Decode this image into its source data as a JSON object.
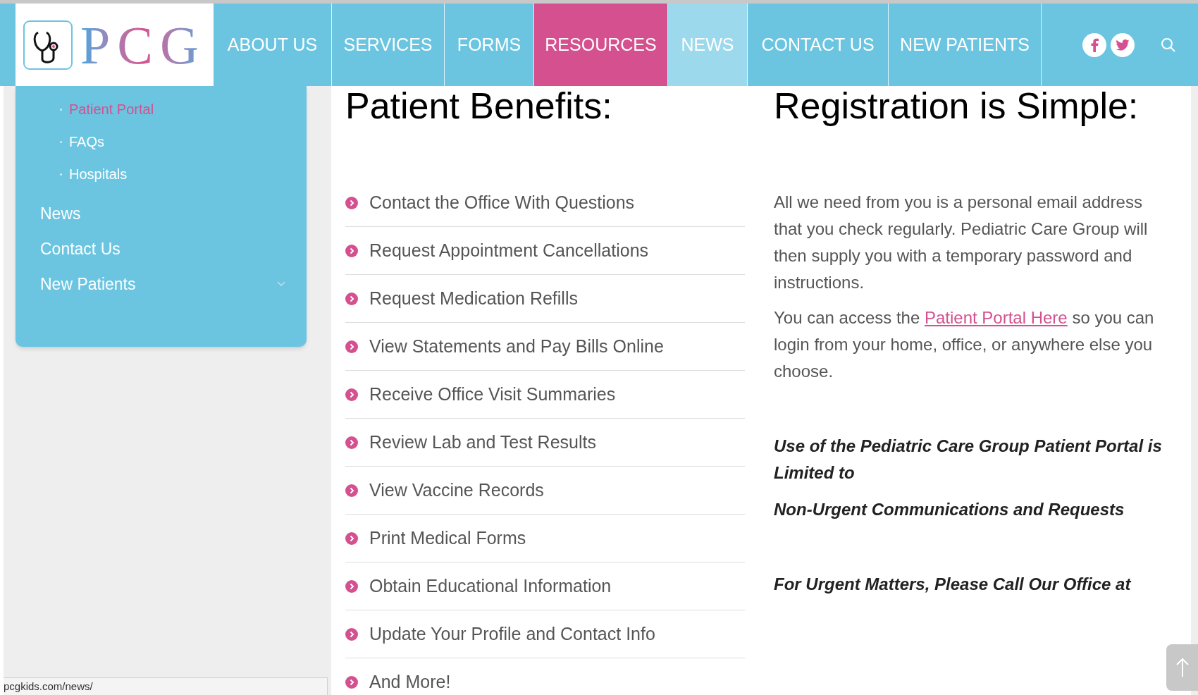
{
  "logo": {
    "text": "PCG"
  },
  "nav": [
    {
      "label": "ABOUT US",
      "selected": false,
      "hovered": false
    },
    {
      "label": "SERVICES",
      "selected": false,
      "hovered": false
    },
    {
      "label": "FORMS",
      "selected": false,
      "hovered": false
    },
    {
      "label": "RESOURCES",
      "selected": true,
      "hovered": false
    },
    {
      "label": "NEWS",
      "selected": false,
      "hovered": true
    },
    {
      "label": "CONTACT US",
      "selected": false,
      "hovered": false
    },
    {
      "label": "NEW PATIENTS",
      "selected": false,
      "hovered": false
    }
  ],
  "sidebar": {
    "subitems": [
      {
        "label": "Patient Portal",
        "selected": true
      },
      {
        "label": "FAQs",
        "selected": false
      },
      {
        "label": "Hospitals",
        "selected": false
      }
    ],
    "items": [
      {
        "label": "News",
        "kind": "link"
      },
      {
        "label": "Contact Us",
        "kind": "link"
      },
      {
        "label": "New Patients",
        "kind": "dropdown"
      }
    ]
  },
  "benefits": {
    "title": "Patient Benefits:",
    "items": [
      "Contact the Office With Questions",
      "Request Appointment Cancellations",
      "Request Medication Refills",
      "View Statements and Pay Bills Online",
      "Receive Office Visit Summaries",
      "Review Lab and Test Results",
      "View Vaccine Records",
      "Print Medical Forms",
      "Obtain Educational Information",
      "Update Your Profile and Contact Info",
      "And More!"
    ]
  },
  "registration": {
    "title": "Registration is Simple:",
    "paragraph": "All we need from you is a personal email address that you check regularly. Pediatric Care Group will then supply you with a temporary password and instructions.",
    "access": {
      "before": "You can access the",
      "link": "Patient Portal Here",
      "after": "so you can login from your home, office, or anywhere else you choose."
    },
    "notes": [
      "Use of the Pediatric Care Group Patient Portal is Limited to",
      "Non-Urgent Communications and Requests",
      "For Urgent Matters, Please Call Our Office at"
    ]
  },
  "status_bar": {
    "url": "pcgkids.com/news/"
  }
}
